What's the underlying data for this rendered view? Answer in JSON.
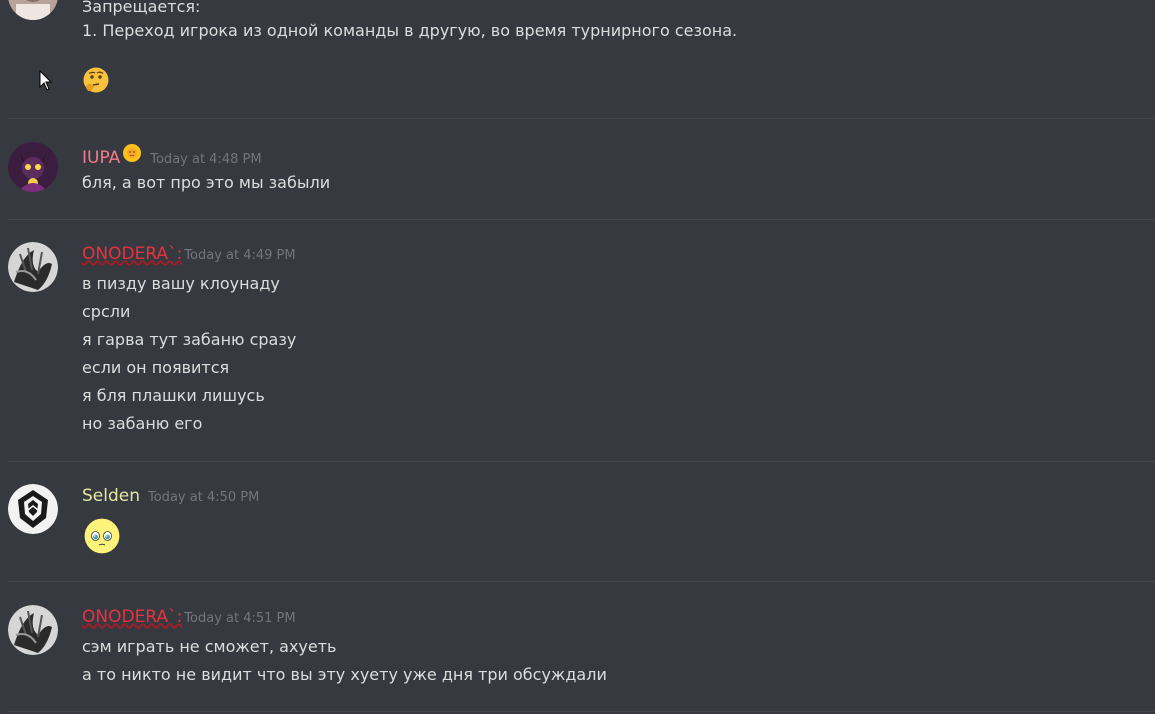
{
  "messages": [
    {
      "id": "m0",
      "continued": true,
      "lines": [
        "Запрещается:",
        "1. Переход игрока из одной команды в другую, во время турнирного сезона."
      ],
      "reaction_emoji": "thinking-face"
    },
    {
      "id": "m1",
      "username": "IUPA",
      "username_color": "#f47b8b",
      "badge_emoji": "sun-face",
      "timestamp": "Today at 4:48 PM",
      "lines": [
        "бля, а вот про это мы забыли"
      ]
    },
    {
      "id": "m2",
      "username": "ONODERA`:",
      "username_color": "#e8323d",
      "timestamp": "Today at 4:49 PM",
      "lines": [
        "в пизду вашу клоунаду",
        "срсли",
        "я гарва тут забаню сразу",
        "если он появится",
        "я бля плашки лишусь",
        "но забаню его"
      ]
    },
    {
      "id": "m3",
      "username": "Selden",
      "username_color": "#e5e8a0",
      "timestamp": "Today at 4:50 PM",
      "emoji": "pleading-face"
    },
    {
      "id": "m4",
      "username": "ONODERA`:",
      "username_color": "#e8323d",
      "timestamp": "Today at 4:51 PM",
      "lines": [
        "сэм играть не сможет, ахуеть",
        "а то никто не видит что вы эту хуету уже дня три обсуждали"
      ]
    }
  ],
  "colors": {
    "background": "#36393f",
    "divider": "#42454a",
    "text": "#dcddde",
    "timestamp": "#72767d"
  }
}
